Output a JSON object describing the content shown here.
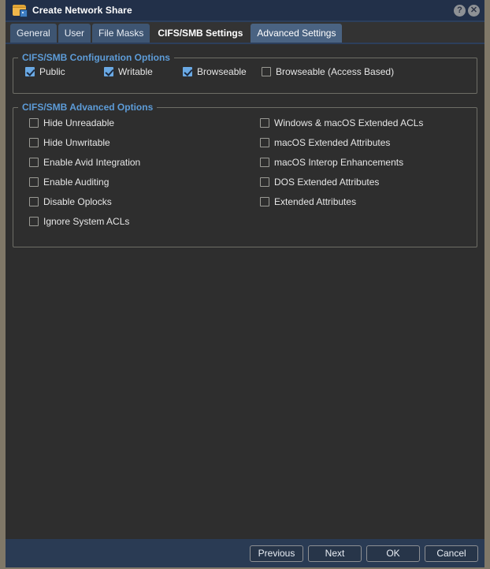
{
  "window": {
    "title": "Create Network Share",
    "icon": "network-share-folder-icon",
    "help_label": "?",
    "close_label": "✕"
  },
  "tabs": [
    {
      "label": "General",
      "state": "normal"
    },
    {
      "label": "User",
      "state": "normal"
    },
    {
      "label": "File Masks",
      "state": "normal"
    },
    {
      "label": "CIFS/SMB Settings",
      "state": "selected"
    },
    {
      "label": "Advanced Settings",
      "state": "current"
    }
  ],
  "config_group": {
    "legend": "CIFS/SMB Configuration Options",
    "options": [
      {
        "label": "Public",
        "checked": true
      },
      {
        "label": "Writable",
        "checked": true
      },
      {
        "label": "Browseable",
        "checked": true
      },
      {
        "label": "Browseable (Access Based)",
        "checked": false
      }
    ]
  },
  "advanced_group": {
    "legend": "CIFS/SMB Advanced Options",
    "left_options": [
      {
        "label": "Hide Unreadable",
        "checked": false
      },
      {
        "label": "Hide Unwritable",
        "checked": false
      },
      {
        "label": "Enable Avid Integration",
        "checked": false
      },
      {
        "label": "Enable Auditing",
        "checked": false
      },
      {
        "label": "Disable Oplocks",
        "checked": false
      },
      {
        "label": "Ignore System ACLs",
        "checked": false
      }
    ],
    "right_options": [
      {
        "label": "Windows & macOS Extended ACLs",
        "checked": false
      },
      {
        "label": "macOS Extended Attributes",
        "checked": false
      },
      {
        "label": "macOS Interop Enhancements",
        "checked": false
      },
      {
        "label": "DOS Extended Attributes",
        "checked": false
      },
      {
        "label": "Extended Attributes",
        "checked": false
      }
    ]
  },
  "footer": {
    "buttons": [
      {
        "label": "Previous"
      },
      {
        "label": "Next"
      },
      {
        "label": "OK"
      },
      {
        "label": "Cancel"
      }
    ]
  },
  "colors": {
    "titlebar": "#223049",
    "body": "#2e2e2e",
    "footer": "#2a3b54",
    "frame": "#807868",
    "legend_text": "#5d9cd8",
    "checkbox_checked": "#6aa9e4",
    "tab_inactive": "#3e5572",
    "tab_current": "#4a6382"
  }
}
